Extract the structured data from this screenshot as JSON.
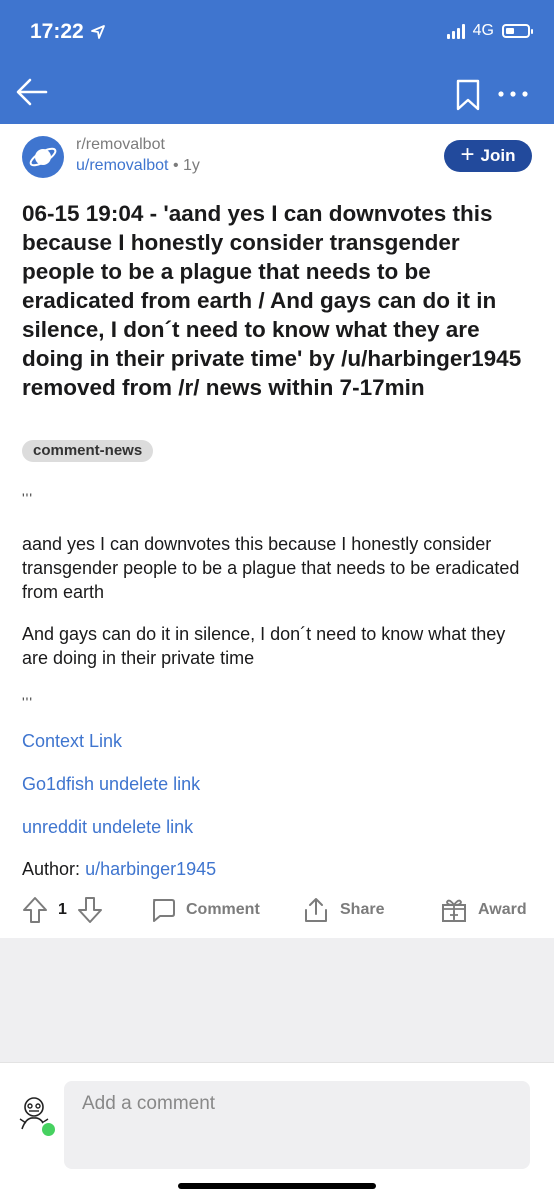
{
  "status_bar": {
    "time": "17:22",
    "network": "4G"
  },
  "nav": {
    "back_icon": "arrow-left-icon",
    "bookmark_icon": "bookmark-icon",
    "more_icon": "more-dots-icon"
  },
  "post": {
    "subreddit": "r/removalbot",
    "author": "u/removalbot",
    "separator": "•",
    "age": "1y",
    "join_label": "Join",
    "title": "06-15 19:04 - 'aand yes I can downvotes this because I honestly consider transgender people to be a plague that needs to be eradicated from earth / And gays can do it in silence, I don´t need to know what they are doing in their private time' by /u/harbinger1945 removed from /r/ news within 7-17min",
    "flair": "comment-news",
    "quote_open": "'''",
    "paragraph1": "aand yes I can downvotes this because I honestly consider transgender people to be a plague that needs to be eradicated from earth",
    "paragraph2": "And gays can do it in silence, I don´t need to know what they are doing in their private time",
    "quote_close": "'''",
    "links": [
      "Context Link",
      "Go1dfish undelete link",
      "unreddit undelete link"
    ],
    "author_label": "Author:",
    "author_link": "u/harbinger1945"
  },
  "actions": {
    "vote_count": "1",
    "comment_label": "Comment",
    "share_label": "Share",
    "award_label": "Award"
  },
  "comment_box": {
    "placeholder": "Add a comment"
  },
  "colors": {
    "header": "#3f75cf",
    "join_button": "#224a9c",
    "link": "#3f75cf",
    "online": "#46d160"
  }
}
